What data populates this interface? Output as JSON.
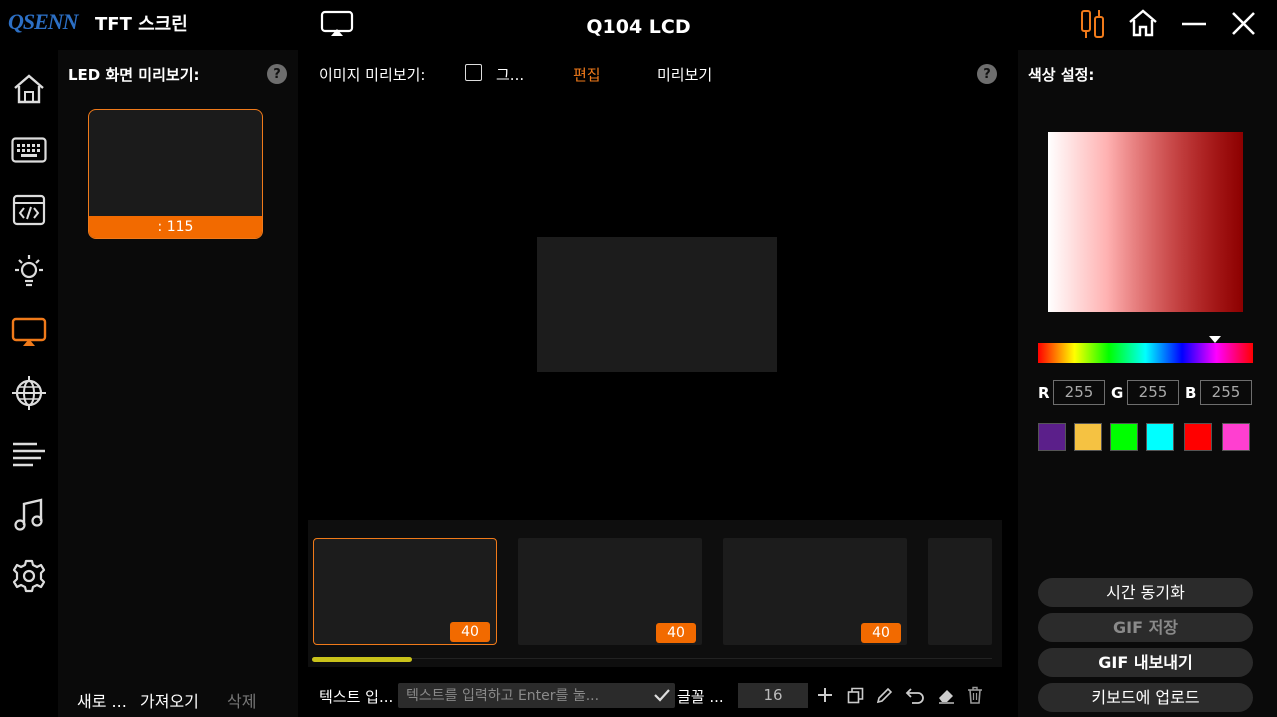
{
  "app": {
    "brand": "QSENN",
    "title": "TFT 스크린",
    "device": "Q104 LCD"
  },
  "colors": {
    "accent": "#f26a00",
    "panel_bg": "#0a0a0a",
    "highlight": "#c9c21a"
  },
  "sidebar": {
    "items": [
      {
        "icon": "home-icon",
        "active": false
      },
      {
        "icon": "keyboard-icon",
        "active": false
      },
      {
        "icon": "code-window-icon",
        "active": false
      },
      {
        "icon": "light-bulb-icon",
        "active": false
      },
      {
        "icon": "screen-cast-icon",
        "active": true
      },
      {
        "icon": "globe-icon",
        "active": false
      },
      {
        "icon": "equalizer-icon",
        "active": false
      },
      {
        "icon": "music-note-icon",
        "active": false
      },
      {
        "icon": "gear-icon",
        "active": false
      }
    ]
  },
  "left_panel": {
    "title": "LED 화면 미리보기:",
    "help": "?",
    "thumb_label": ": 115",
    "actions": {
      "new": "새로 ...",
      "import": "가져오기",
      "delete": "삭제"
    }
  },
  "center": {
    "preview_label": "이미지 미리보기:",
    "checkbox_label": "그...",
    "tab_edit": "편집",
    "tab_preview": "미리보기",
    "help": "?",
    "frames": [
      {
        "count": "40"
      },
      {
        "count": "40"
      },
      {
        "count": "40"
      }
    ],
    "toolbar": {
      "text_label": "텍스트 입...",
      "text_placeholder": "텍스트를 입력하고 Enter를 눌...",
      "font_label": "글꼴 ...",
      "font_size": "16"
    }
  },
  "right_panel": {
    "title": "색상 설정:",
    "r_label": "R",
    "g_label": "G",
    "b_label": "B",
    "r_value": "255",
    "g_value": "255",
    "b_value": "255",
    "swatches": [
      "#5b1f8a",
      "#f5c242",
      "#00ff00",
      "#00ffff",
      "#ff0000",
      "#ff3fd0"
    ],
    "buttons": {
      "time_sync": "시간 동기화",
      "gif_save": "GIF 저장",
      "gif_export": "GIF 내보내기",
      "upload": "키보드에 업로드"
    }
  }
}
